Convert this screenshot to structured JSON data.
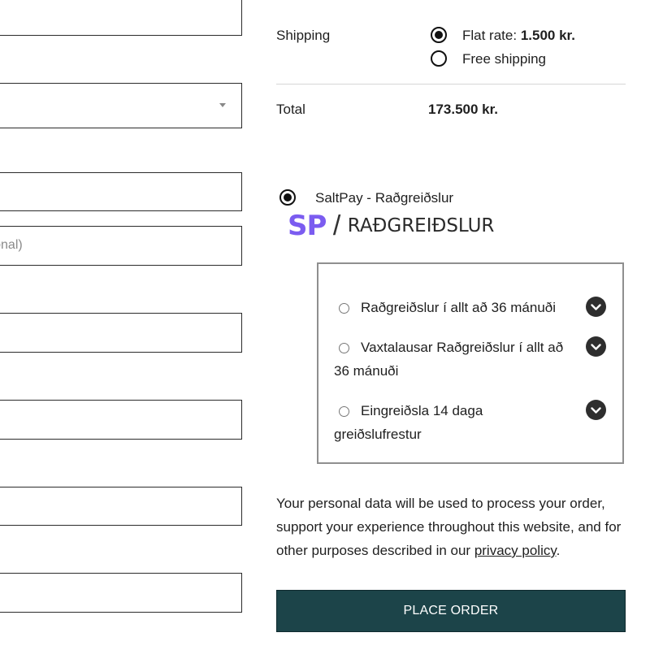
{
  "billing_form": {
    "company_placeholder": "(optional)",
    "country_select": {
      "selected_value": ""
    }
  },
  "order_summary": {
    "shipping_label": "Shipping",
    "shipping_options": [
      {
        "label": "Flat rate: ",
        "price": "1.500 kr.",
        "selected": true
      },
      {
        "label": "Free shipping",
        "price": "",
        "selected": false
      }
    ],
    "total_label": "Total",
    "total_value": "173.500 kr."
  },
  "payment": {
    "method_label": "SaltPay - Raðgreiðslur",
    "method_selected": true,
    "logo_mark": "SP",
    "logo_text": "RAÐGREIÐSLUR",
    "plans": [
      {
        "line1": "Raðgreiðslur í allt að 36 mánuði",
        "line2": ""
      },
      {
        "line1": "Vaxtalausar Raðgreiðslur í allt að",
        "line2": "36 mánuði"
      },
      {
        "line1": "Eingreiðsla 14 daga",
        "line2": "greiðslufrestur"
      }
    ],
    "logo_color": "#7b5cf0"
  },
  "privacy": {
    "text_before": "Your personal data will be used to process your order, support your experience throughout this website, and for other purposes described in our ",
    "link_text": "privacy policy",
    "text_after": "."
  },
  "place_order_label": "PLACE ORDER",
  "colors": {
    "button_bg": "#1c4449",
    "chevron_bg": "#2e2e2e"
  }
}
